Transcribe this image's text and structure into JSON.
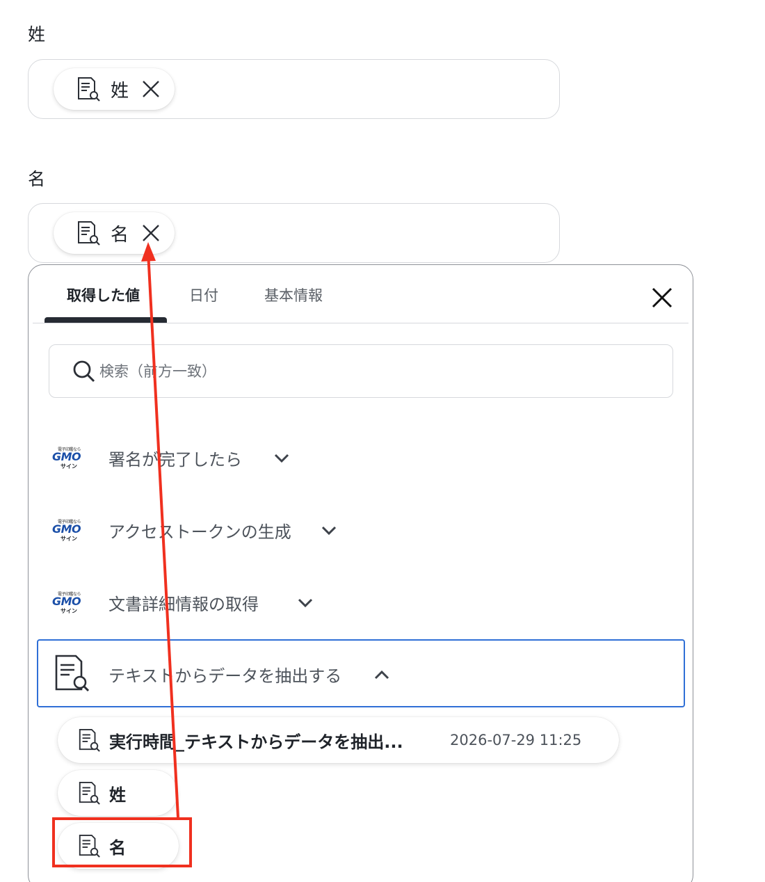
{
  "fields": [
    {
      "label": "姓",
      "chip_text": "姓"
    },
    {
      "label": "名",
      "chip_text": "名"
    }
  ],
  "panel": {
    "tabs": [
      "取得した値",
      "日付",
      "基本情報"
    ],
    "active_tab": "取得した値",
    "search_placeholder": "検索（前方一致）",
    "groups": [
      {
        "label": "署名が完了したら",
        "icon": "gmo-sign-logo",
        "expanded": false
      },
      {
        "label": "アクセストークンの生成",
        "icon": "gmo-sign-logo",
        "expanded": false
      },
      {
        "label": "文書詳細情報の取得",
        "icon": "gmo-sign-logo",
        "expanded": false
      },
      {
        "label": "テキストからデータを抽出する",
        "icon": "document-search-icon",
        "expanded": true
      }
    ],
    "values": [
      {
        "label": "実行時間_テキストからデータを抽出...",
        "timestamp": "2026-07-29 11:25"
      },
      {
        "label": "姓"
      },
      {
        "label": "名"
      }
    ]
  },
  "logo": {
    "top_text": "電子印鑑なら",
    "brand": "GMO",
    "bottom_text": "サイン"
  },
  "colors": {
    "accent_border": "#2f6fd6",
    "annotation_red": "#f0301f",
    "logo_blue": "#1b4fa8"
  }
}
